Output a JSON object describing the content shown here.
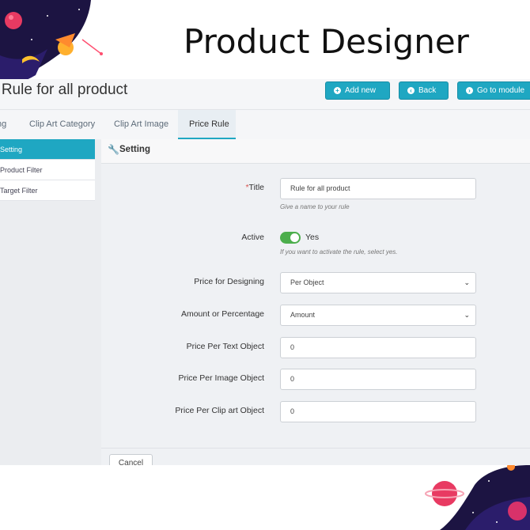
{
  "banner": {
    "heading": "Product Designer"
  },
  "header": {
    "page_title": "t: Rule for all product",
    "buttons": {
      "add_new": "Add new",
      "back": "Back",
      "go_to_module": "Go to module"
    }
  },
  "tabs": [
    {
      "label": "ng"
    },
    {
      "label": "Clip Art Category"
    },
    {
      "label": "Clip Art Image"
    },
    {
      "label": "Price Rule",
      "active": true
    }
  ],
  "sidebar": {
    "items": [
      {
        "label": "Setting",
        "active": true
      },
      {
        "label": "Product Filter"
      },
      {
        "label": "Target Filter"
      }
    ]
  },
  "panel": {
    "title": "Setting",
    "icon": "wrench-icon",
    "fields": {
      "title": {
        "label": "Title",
        "value": "Rule for all product",
        "help": "Give a name to your rule"
      },
      "active": {
        "label": "Active",
        "value": "Yes",
        "help": "If you want to activate the rule, select yes."
      },
      "price_for_designing": {
        "label": "Price for Designing",
        "value": "Per Object"
      },
      "amount_or_percentage": {
        "label": "Amount or Percentage",
        "value": "Amount"
      },
      "price_per_text": {
        "label": "Price Per Text Object",
        "value": "0"
      },
      "price_per_image": {
        "label": "Price Per Image Object",
        "value": "0"
      },
      "price_per_clipart": {
        "label": "Price Per Clip art Object",
        "value": "0"
      }
    },
    "cancel_label": "Cancel"
  },
  "colors": {
    "accent": "#1fa7c2",
    "toggle_on": "#4cae4c",
    "required": "#d9534f"
  }
}
